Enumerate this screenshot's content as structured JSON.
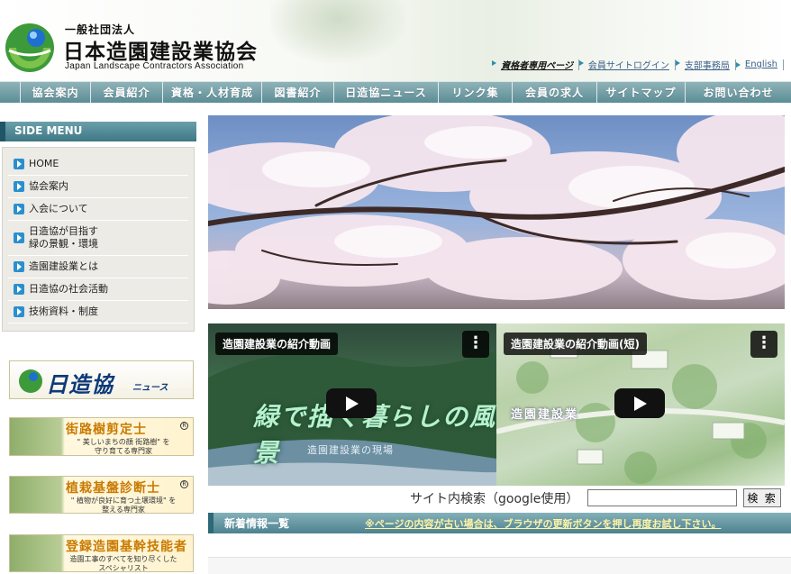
{
  "header": {
    "org_type": "一般社団法人",
    "org_name": "日本造園建設業協会",
    "org_name_en": "Japan Landscape Contractors Association",
    "links": [
      {
        "label": "資格者専用ページ"
      },
      {
        "label": "会員サイトログイン"
      },
      {
        "label": "支部事務局"
      },
      {
        "label": "English"
      }
    ]
  },
  "nav": {
    "items": [
      {
        "label": "協会案内"
      },
      {
        "label": "会員紹介"
      },
      {
        "label": "資格・人材育成"
      },
      {
        "label": "図書紹介"
      },
      {
        "label": "日造協ニュース"
      },
      {
        "label": "リンク集"
      },
      {
        "label": "会員の求人"
      },
      {
        "label": "サイトマップ"
      },
      {
        "label": "お問い合わせ"
      }
    ]
  },
  "sidebar": {
    "title": "SIDE MENU",
    "items": [
      {
        "label": "HOME"
      },
      {
        "label": "協会案内"
      },
      {
        "label": "入会について"
      },
      {
        "label": "日造協が目指す\n緑の景観・環境"
      },
      {
        "label": "造園建設業とは"
      },
      {
        "label": "日造協の社会活動"
      },
      {
        "label": "技術資料・制度"
      }
    ],
    "banners": {
      "news": {
        "title": "日造協",
        "sub": "ニュース"
      },
      "tree": {
        "title": "街路樹剪定士",
        "sub": "\" 美しいまちの顔 街路樹\" を\n守り育てる専門家"
      },
      "soil": {
        "title": "植栽基盤診断士",
        "sub": "\" 植物が良好に育つ土壌環境\" を\n整える専門家"
      },
      "cert": {
        "title": "登録造園基幹技能者",
        "sub": "造園工事のすべてを知り尽くした\nスペシャリスト"
      }
    }
  },
  "videos": [
    {
      "title": "造園建設業の紹介動画",
      "caption": "緑で描く暮らしの風景",
      "caption2": "造園建設業の現場"
    },
    {
      "title": "造園建設業の紹介動画(短)",
      "caption": "造園建設業"
    }
  ],
  "search": {
    "label": "サイト内検索（google使用）",
    "value": "",
    "button": "検 索"
  },
  "news": {
    "heading": "新着情報一覧",
    "note": "※ページの内容が古い場合は、ブラウザの更新ボタンを押し再度お試し下さい。"
  },
  "colors": {
    "nav": "#5b8d96",
    "side_icon": "#2a8fd0",
    "banner_title": "#c97a00",
    "news_title": "#0e3a7a"
  }
}
